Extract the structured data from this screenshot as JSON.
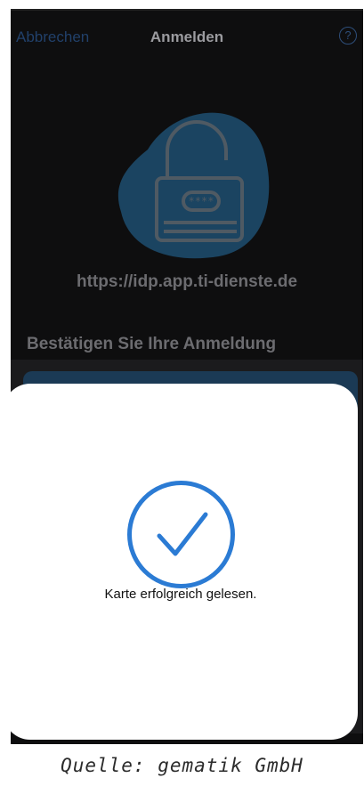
{
  "nav": {
    "cancel_label": "Abbrechen",
    "title": "Anmelden",
    "help_icon_glyph": "?"
  },
  "login": {
    "host_url": "https://idp.app.ti-dienste.de",
    "confirm_heading": "Bestätigen Sie Ihre Anmeldung",
    "lock_pin_mask": "****"
  },
  "sheet": {
    "message": "Karte erfolgreich gelesen."
  },
  "caption": "Quelle: gematik GmbH",
  "colors": {
    "accent": "#2b7bd4",
    "dim_accent": "#21406a",
    "blob": "#1d4a6a"
  }
}
